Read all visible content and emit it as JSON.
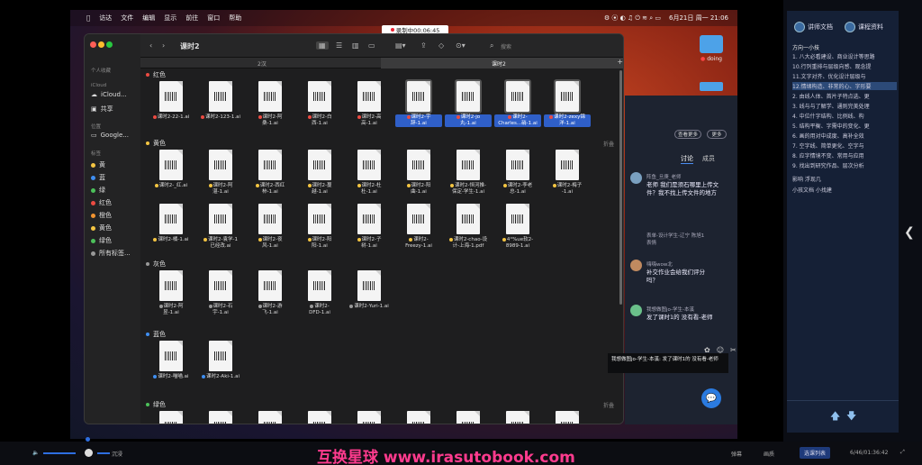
{
  "mac_menu": {
    "items": [
      "访达",
      "文件",
      "编辑",
      "显示",
      "前往",
      "窗口",
      "帮助"
    ],
    "clock": "6月21日 周一 21:06"
  },
  "recording": "录制中00:06:45",
  "desktop": {
    "folders": [
      "doing"
    ]
  },
  "finder": {
    "title": "课时2",
    "search_placeholder": "搜索",
    "tabs": [
      "2汉",
      "课时2"
    ],
    "sidebar": {
      "sec_personal": "个人收藏",
      "sec_icloud": "iCloud",
      "icloud_drive": "iCloud...",
      "shared": "共享",
      "sec_location": "位置",
      "google": "Google...",
      "sec_tags": "标签",
      "tags": [
        {
          "name": "黄",
          "color": "#f4c542"
        },
        {
          "name": "蓝",
          "color": "#3f8ef0"
        },
        {
          "name": "绿",
          "color": "#4cc15a"
        },
        {
          "name": "红色",
          "color": "#ec4b42"
        },
        {
          "name": "橙色",
          "color": "#f29430"
        },
        {
          "name": "黄色",
          "color": "#f4c542"
        },
        {
          "name": "绿色",
          "color": "#4cc15a"
        },
        {
          "name": "所有标签...",
          "color": "#999999"
        }
      ]
    },
    "groups": [
      {
        "name": "红色",
        "color": "#ec4b42",
        "more": "",
        "files": [
          {
            "l1": "课时2-22-1.ai"
          },
          {
            "l1": "课时2-123-1.ai"
          },
          {
            "l1": "课时2-阿",
            "l2": "桑-1.ai"
          },
          {
            "l1": "课时2-白",
            "l2": "西-1.ai"
          },
          {
            "l1": "课时2-高",
            "l2": "高-1.ai"
          },
          {
            "l1": "课时2-宇",
            "l2": "辞-1.ai",
            "sel": true
          },
          {
            "l1": "课时2-jo",
            "l2": "丸-1.ai",
            "sel": true
          },
          {
            "l1": "课时2-",
            "l2": "Charles...硝-1.ai",
            "sel": true
          },
          {
            "l1": "课时2-zexy锦",
            "l2": "洋-1.ai",
            "sel": true
          }
        ]
      },
      {
        "name": "黄色",
        "color": "#f4c542",
        "more": "折叠",
        "files": [
          {
            "l1": "课时2-_红.ai"
          },
          {
            "l1": "课时2-阿",
            "l2": "湛-1.ai"
          },
          {
            "l1": "课时2-西红",
            "l2": "柿-1.ai"
          },
          {
            "l1": "课时2-蔓",
            "l2": "越-1.ai"
          },
          {
            "l1": "课时2-杜",
            "l2": "杜-1.ai"
          },
          {
            "l1": "课时2-阳",
            "l2": "曲-1.ai"
          },
          {
            "l1": "课时2-恒河推-",
            "l2": "保定-学生-1.ai"
          },
          {
            "l1": "课时2-李老",
            "l2": "总-1.ai"
          },
          {
            "l1": "课时2-梅子",
            "l2": "-1.ai"
          },
          {
            "l1": "课时2-橘-1.ai"
          },
          {
            "l1": "课时2-袁学-1",
            "l2": "已经改.ai"
          },
          {
            "l1": "课时2-夜",
            "l2": "风-1.ai"
          },
          {
            "l1": "课时2-阳",
            "l2": "阳-1.ai"
          },
          {
            "l1": "课时2-子",
            "l2": "树-1.ai"
          },
          {
            "l1": "课时2-",
            "l2": "Freezy-1.ai"
          },
          {
            "l1": "课时2-chao-设",
            "l2": "计-上海-1.pdf"
          },
          {
            "l1": "4°%ue软2-",
            "l2": "8989-1.ai"
          }
        ]
      },
      {
        "name": "灰色",
        "color": "#999999",
        "more": "",
        "files": [
          {
            "l1": "课时2-阿",
            "l2": "昱-1.ai"
          },
          {
            "l1": "课时2-石",
            "l2": "宇-1.ai"
          },
          {
            "l1": "课时2-游",
            "l2": "飞-1.ai"
          },
          {
            "l1": "课时2-",
            "l2": "DFD-1.ai"
          },
          {
            "l1": "课时2-Yuri-1.ai"
          }
        ]
      },
      {
        "name": "蓝色",
        "color": "#3f8ef0",
        "more": "",
        "files": [
          {
            "l1": "课时2-喵喵.ai"
          },
          {
            "l1": "课时2-Aki-1.ai"
          }
        ]
      },
      {
        "name": "绿色",
        "color": "#4cc15a",
        "more": "折叠",
        "files": []
      }
    ]
  },
  "chat": {
    "buttons": [
      "查看更多",
      "更多"
    ],
    "tabs": [
      "讨论",
      "成员"
    ],
    "messages": [
      {
        "name": "阵鱼_旦庚_老师",
        "text": "老师 我们是须石哪里上传文件？我不找上传文件的地方"
      },
      {
        "name": "表单-设计学生-辽宁 陈旭1 ",
        "text": "表情"
      },
      {
        "name": "嗨嗨wow北",
        "text": "补交作业会给我们评分吗？"
      },
      {
        "name": "我想做图jo-学生-本溪",
        "text": "发了课时1的 没有看-老师"
      }
    ],
    "tooltip": "我想做图jo-学生-本溪: 发了课时1的 没有看-老师"
  },
  "right_panel": {
    "btn1": "讲师文档",
    "btn2": "课程资料",
    "outline_title": "方向一小技",
    "lines": [
      "1. 八大必看建设、商业设计等思路",
      "10.行列重排与层级向感、观念提",
      "11.文字对齐、优化设计层级与",
      "12.情绪构造、非常的心、字形要",
      "2. 由线人体、首片子特点选、更",
      "3. 线与与了解学、通则完美处理",
      "4. 中位什字结构、比例线、构",
      "5. 结构平衡、字需中的变化、更",
      "6. 画的用对中成度、高补全效",
      "7. 空字线、简单更化、空字与",
      "8. 应字情境不变、常用与应用",
      "9. 找出到研究作品、层次分析"
    ],
    "extra": [
      "影响 浮现几",
      "小孩文档 小找建"
    ]
  },
  "player": {
    "left_label": "沉浸",
    "show_comment": "弹幕",
    "left_label2": "画质",
    "right_label": "选课列表",
    "time": "6/46/01:36:42"
  },
  "watermark": "互换星球 www.irasutobook.com"
}
